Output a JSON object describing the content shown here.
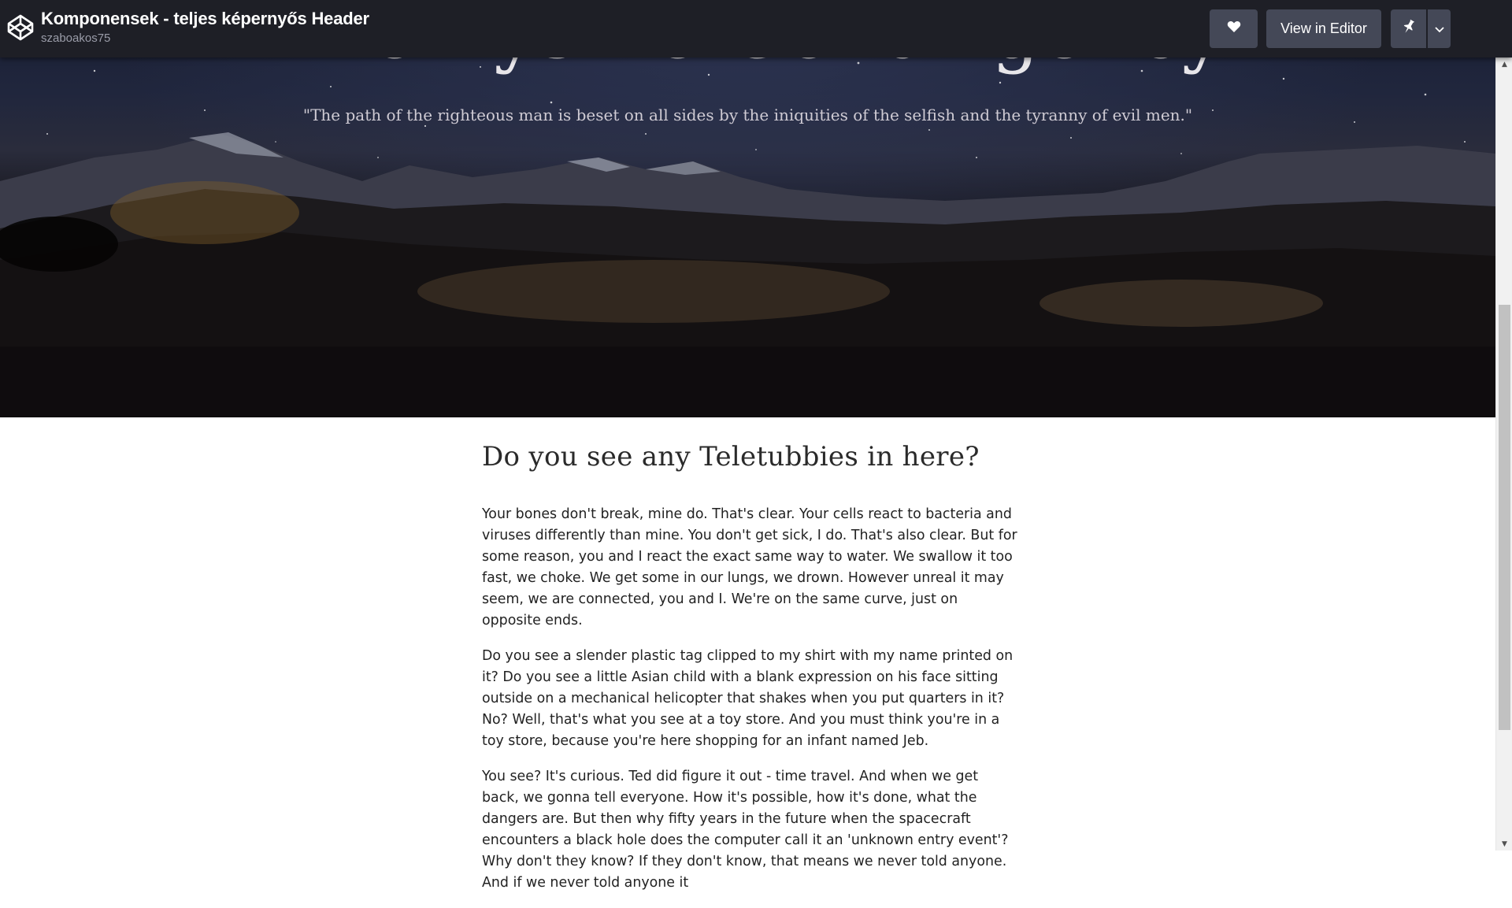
{
  "topbar": {
    "title": "Komponensek - teljes képernyős Header",
    "author": "szaboakos75",
    "heart_icon": "heart-icon",
    "view_in_editor_label": "View in Editor",
    "pin_icon": "pin-icon",
    "dropdown_icon": "chevron-down-icon"
  },
  "hero": {
    "title": "The Lysine Contingency",
    "quote": "\"The path of the righteous man is beset on all sides by the iniquities of the selfish and the tyranny of evil men.\""
  },
  "article": {
    "heading": "Do you see any Teletubbies in here?",
    "paragraphs": [
      "Your bones don't break, mine do. That's clear. Your cells react to bacteria and viruses differently than mine. You don't get sick, I do. That's also clear. But for some reason, you and I react the exact same way to water. We swallow it too fast, we choke. We get some in our lungs, we drown. However unreal it may seem, we are connected, you and I. We're on the same curve, just on opposite ends.",
      "Do you see a slender plastic tag clipped to my shirt with my name printed on it? Do you see a little Asian child with a blank expression on his face sitting outside on a mechanical helicopter that shakes when you put quarters in it? No? Well, that's what you see at a toy store. And you must think you're in a toy store, because you're here shopping for an infant named Jeb.",
      "You see? It's curious. Ted did figure it out - time travel. And when we get back, we gonna tell everyone. How it's possible, how it's done, what the dangers are. But then why fifty years in the future when the spacecraft encounters a black hole does the computer call it an 'unknown entry event'? Why don't they know? If they don't know, that means we never told anyone. And if we never told anyone it"
    ]
  }
}
